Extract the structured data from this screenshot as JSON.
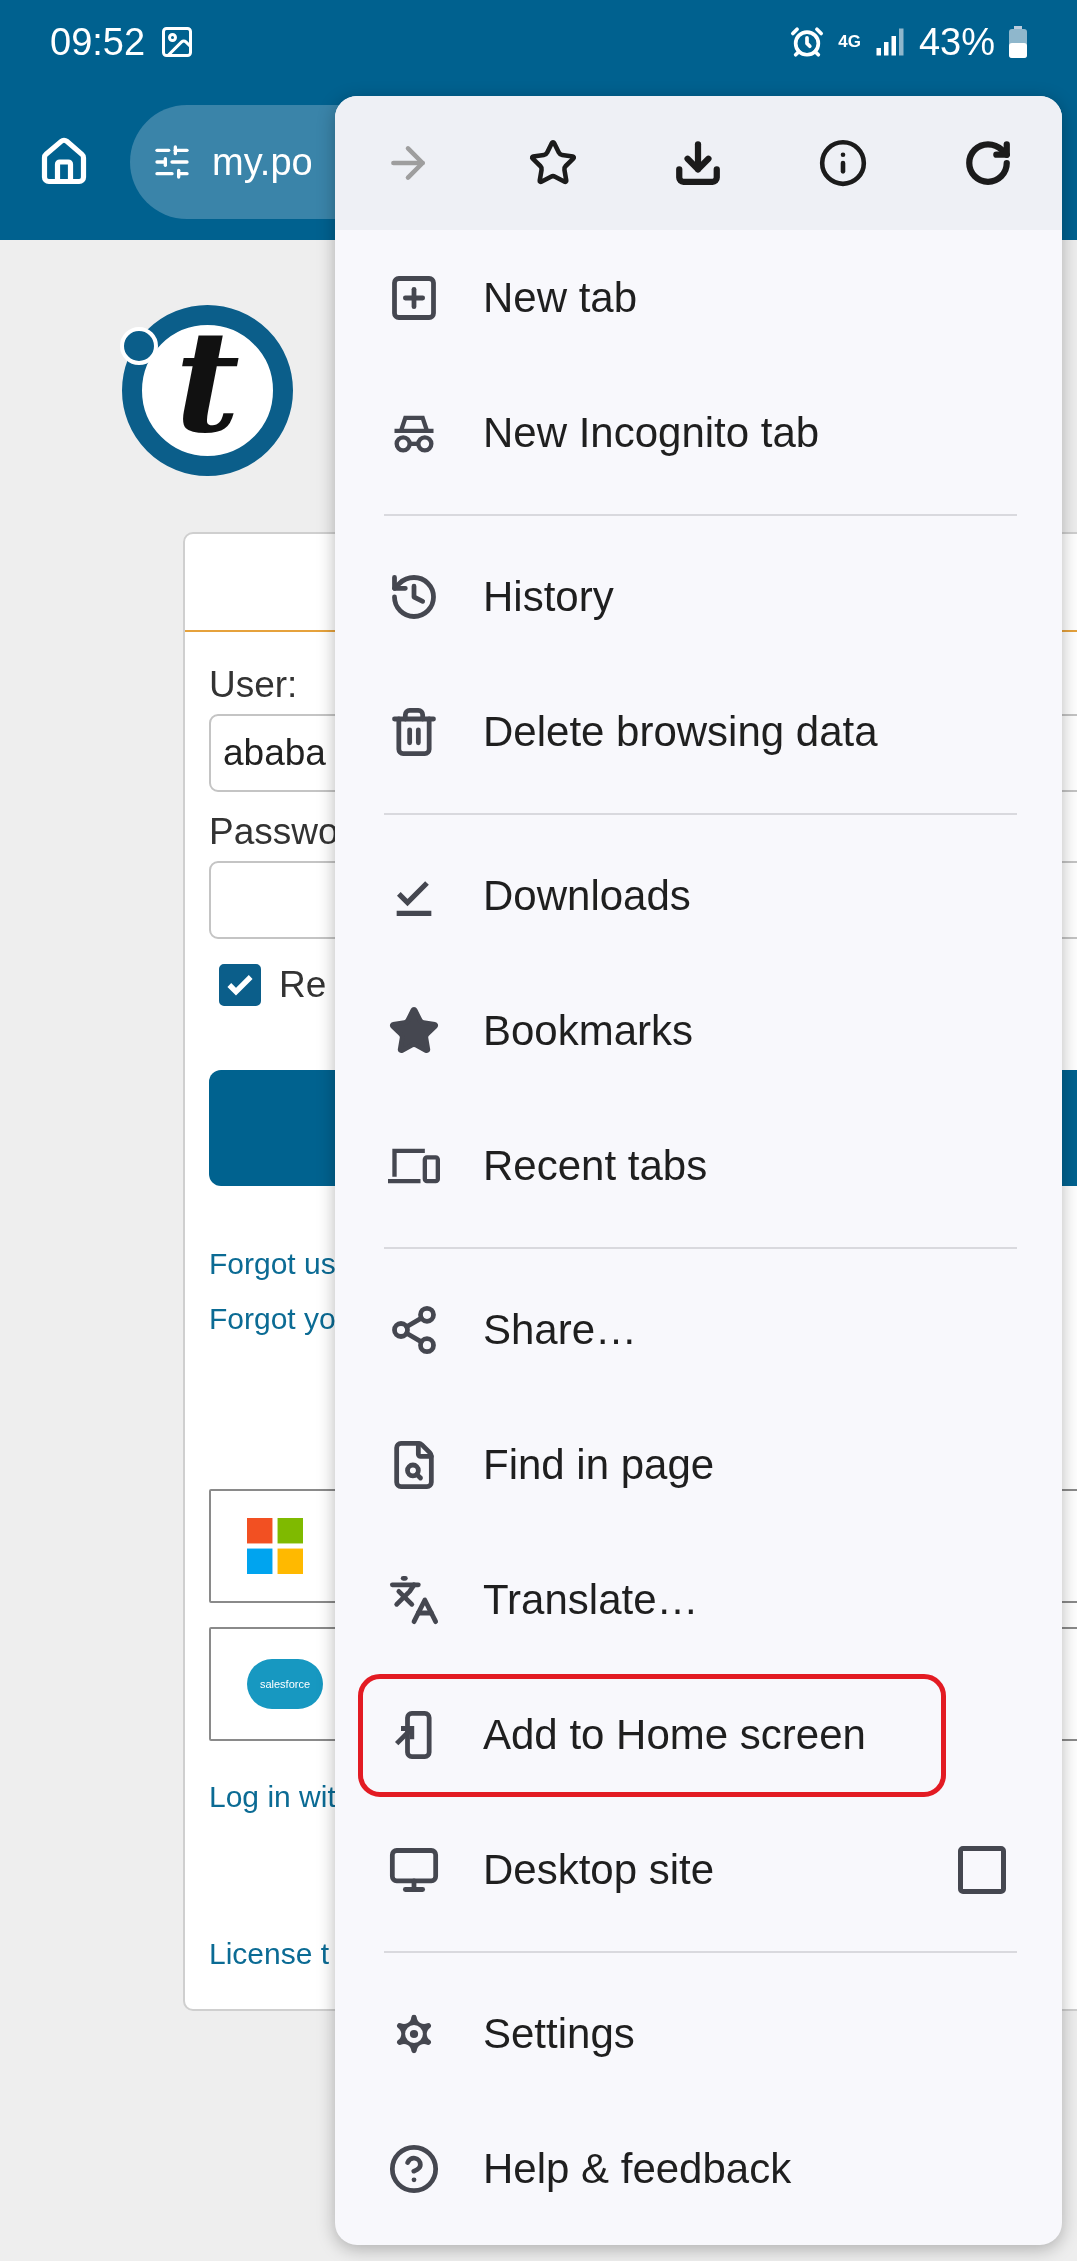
{
  "status_bar": {
    "time": "09:52",
    "network": "4G",
    "battery": "43%"
  },
  "toolbar": {
    "url": "my.po"
  },
  "page": {
    "logo_letter": "t",
    "user_label": "User:",
    "user_value": "ababa",
    "password_label": "Passwo",
    "remember": {
      "label": "Re",
      "checked": true
    },
    "links": [
      "Forgot us",
      "Forgot yo"
    ],
    "sso_buttons": [
      {
        "kind": "microsoft"
      },
      {
        "kind": "salesforce",
        "logo_text": "salesforce"
      }
    ],
    "sso_link": "Log in wit",
    "footer_link": "License t"
  },
  "menu": {
    "actions": [
      {
        "kind": "forward",
        "disabled": true
      },
      {
        "kind": "bookmark",
        "disabled": false
      },
      {
        "kind": "download",
        "disabled": false
      },
      {
        "kind": "info",
        "disabled": false
      },
      {
        "kind": "refresh",
        "disabled": false
      }
    ],
    "groups": [
      {
        "items": [
          {
            "kind": "newtab",
            "label": "New tab",
            "highlighted": false
          },
          {
            "kind": "incognito",
            "label": "New Incognito tab",
            "highlighted": false
          }
        ]
      },
      {
        "items": [
          {
            "kind": "history",
            "label": "History",
            "highlighted": false
          },
          {
            "kind": "trash",
            "label": "Delete browsing data",
            "highlighted": false
          }
        ]
      },
      {
        "items": [
          {
            "kind": "downloads",
            "label": "Downloads",
            "highlighted": false
          },
          {
            "kind": "bookmarks",
            "label": "Bookmarks",
            "highlighted": false
          },
          {
            "kind": "devices",
            "label": "Recent tabs",
            "highlighted": false
          }
        ]
      },
      {
        "items": [
          {
            "kind": "share",
            "label": "Share…",
            "highlighted": false
          },
          {
            "kind": "find",
            "label": "Find in page",
            "highlighted": false
          },
          {
            "kind": "translate",
            "label": "Translate…",
            "highlighted": false
          },
          {
            "kind": "addhome",
            "label": "Add to Home screen",
            "highlighted": true
          },
          {
            "kind": "desktop",
            "label": "Desktop site",
            "highlighted": false,
            "checked": false
          }
        ]
      },
      {
        "items": [
          {
            "kind": "settings",
            "label": "Settings",
            "highlighted": false
          },
          {
            "kind": "help",
            "label": "Help & feedback",
            "highlighted": false
          }
        ]
      }
    ]
  }
}
